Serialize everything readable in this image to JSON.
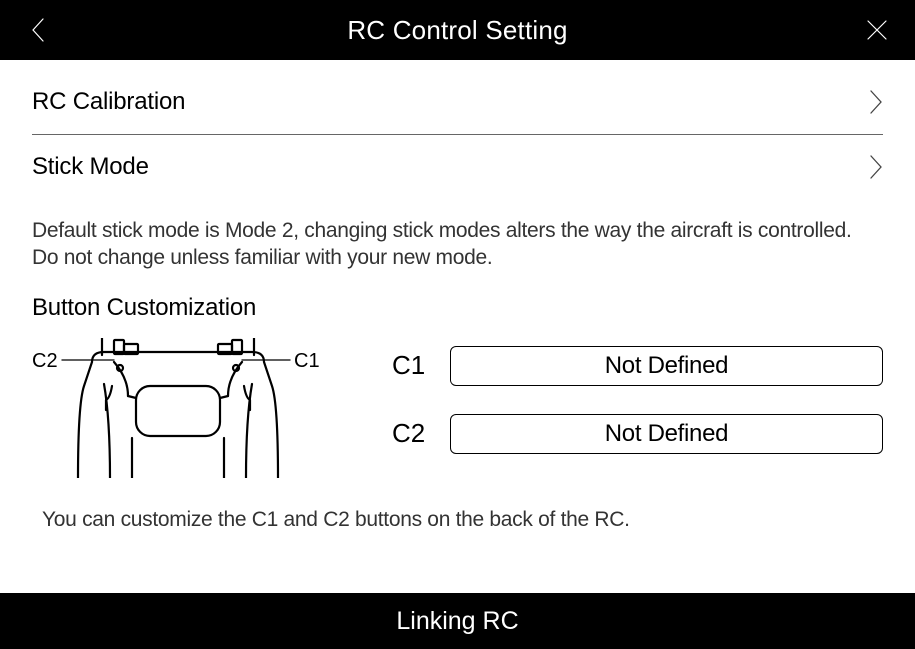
{
  "header": {
    "title": "RC Control Setting"
  },
  "rows": {
    "calibration": "RC Calibration",
    "stickMode": "Stick Mode"
  },
  "stickModeHint": "Default stick mode is Mode 2, changing stick modes alters the way the aircraft is controlled. Do not change unless familiar with your new mode.",
  "buttonCustom": {
    "title": "Button Customization",
    "diagram": {
      "c1Label": "C1",
      "c2Label": "C2"
    },
    "buttons": [
      {
        "label": "C1",
        "value": "Not Defined"
      },
      {
        "label": "C2",
        "value": "Not Defined"
      }
    ],
    "footnote": "You can customize the C1 and C2 buttons on the back of the RC."
  },
  "footer": {
    "linking": "Linking RC"
  }
}
